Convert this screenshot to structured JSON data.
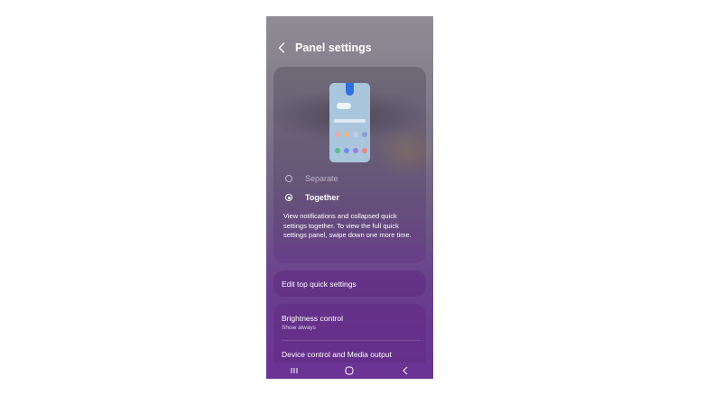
{
  "header": {
    "title": "Panel settings",
    "back_icon": "chevron-left-icon"
  },
  "layout_options": [
    {
      "label": "Separate",
      "selected": false
    },
    {
      "label": "Together",
      "selected": true
    }
  ],
  "description": "View notifications and collapsed quick settings together. To view the full quick settings panel, swipe down one more time.",
  "edit_row": {
    "label": "Edit top quick settings"
  },
  "brightness": {
    "label": "Brightness control",
    "sub": "Show always"
  },
  "device_control": {
    "label": "Device control and Media output"
  },
  "navbar": {
    "icons": [
      "recents-icon",
      "home-icon",
      "back-icon"
    ]
  },
  "colors": {
    "accent": "#6b3394",
    "preview_bg": "#a9c6dc",
    "notch": "#2f6ee0"
  }
}
